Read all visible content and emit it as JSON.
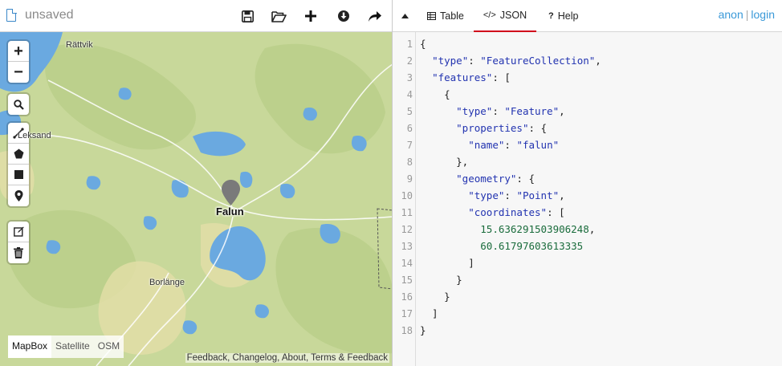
{
  "file": {
    "name": "unsaved"
  },
  "toolbar": {
    "save_icon": "save-icon",
    "open_icon": "folder-open-icon",
    "new_icon": "plus-icon",
    "download_icon": "download-icon",
    "share_icon": "share-arrow-icon"
  },
  "map": {
    "controls": {
      "zoom_in": "+",
      "zoom_out": "−"
    },
    "labels": {
      "rattvik": "Rättvik",
      "leksand": "Leksand",
      "falun": "Falun",
      "borlange": "Borlänge"
    },
    "layers": [
      "MapBox",
      "Satellite",
      "OSM"
    ],
    "active_layer": "MapBox",
    "attribution": "Feedback, Changelog, About, Terms & Feedback",
    "colors": {
      "land": "#c8d89a",
      "water": "#6aa9e0",
      "marker": "#7a7a7a"
    }
  },
  "tabs": {
    "table": "Table",
    "json": "JSON",
    "help": "Help",
    "active": "JSON"
  },
  "auth": {
    "anon": "anon",
    "separator": "|",
    "login": "login"
  },
  "editor": {
    "line_numbers": [
      "1",
      "2",
      "3",
      "4",
      "5",
      "6",
      "7",
      "8",
      "9",
      "10",
      "11",
      "12",
      "13",
      "14",
      "15",
      "16",
      "17",
      "18"
    ],
    "json": {
      "type_key": "\"type\"",
      "type_value": "\"FeatureCollection\"",
      "features_key": "\"features\"",
      "feature_type_value": "\"Feature\"",
      "properties_key": "\"properties\"",
      "name_key": "\"name\"",
      "name_value": "\"falun\"",
      "geometry_key": "\"geometry\"",
      "geometry_type_value": "\"Point\"",
      "coordinates_key": "\"coordinates\"",
      "lon": "15.636291503906248",
      "lat": "60.61797603613335"
    }
  }
}
